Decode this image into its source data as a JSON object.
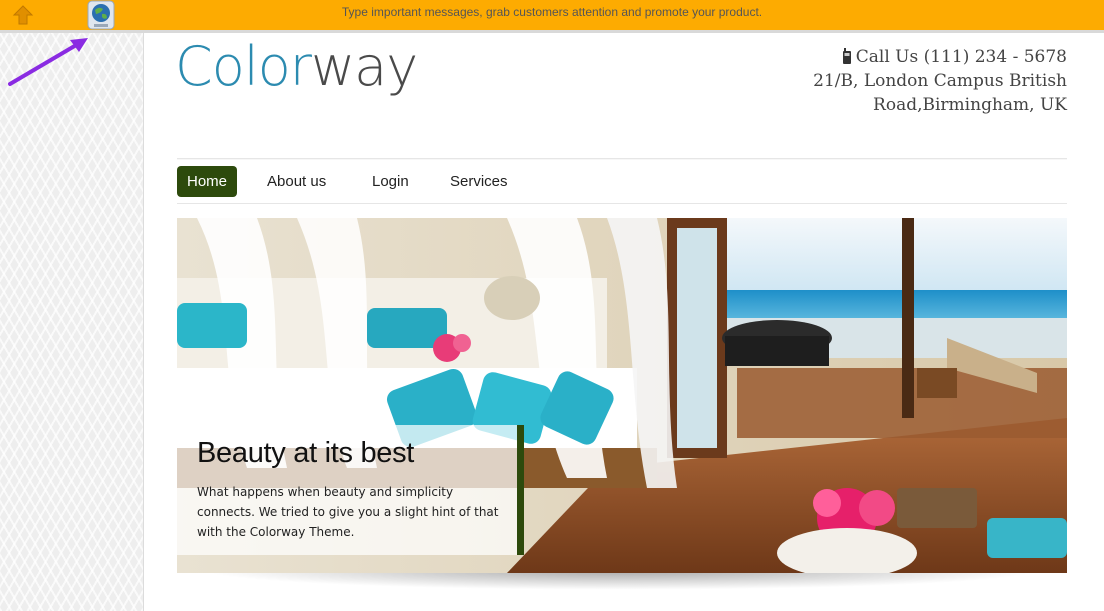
{
  "topbar": {
    "message": "Type important messages, grab customers attention and promote your product."
  },
  "logo": {
    "part1": "Color",
    "part2": "way"
  },
  "contact": {
    "phone": "Call Us (111) 234 - 5678",
    "address_line1": "21/B, London Campus British",
    "address_line2": "Road,Birmingham, UK"
  },
  "nav": {
    "items": [
      {
        "label": "Home",
        "active": true
      },
      {
        "label": "About us"
      },
      {
        "label": "Login"
      },
      {
        "label": "Services"
      }
    ]
  },
  "hero": {
    "title": "Beauty at its best",
    "body": "What happens when beauty and simplicity connects. We tried to give you a slight hint of that with the Colorway Theme."
  },
  "colors": {
    "topbar": "#fdab01",
    "accent_green": "#2d4a0c",
    "logo_blue": "#2c8bb0",
    "pointer_purple": "#8a2be2"
  },
  "icons": [
    "up-arrow-icon",
    "globe-icon",
    "phone-icon",
    "pointer-arrow-icon"
  ]
}
